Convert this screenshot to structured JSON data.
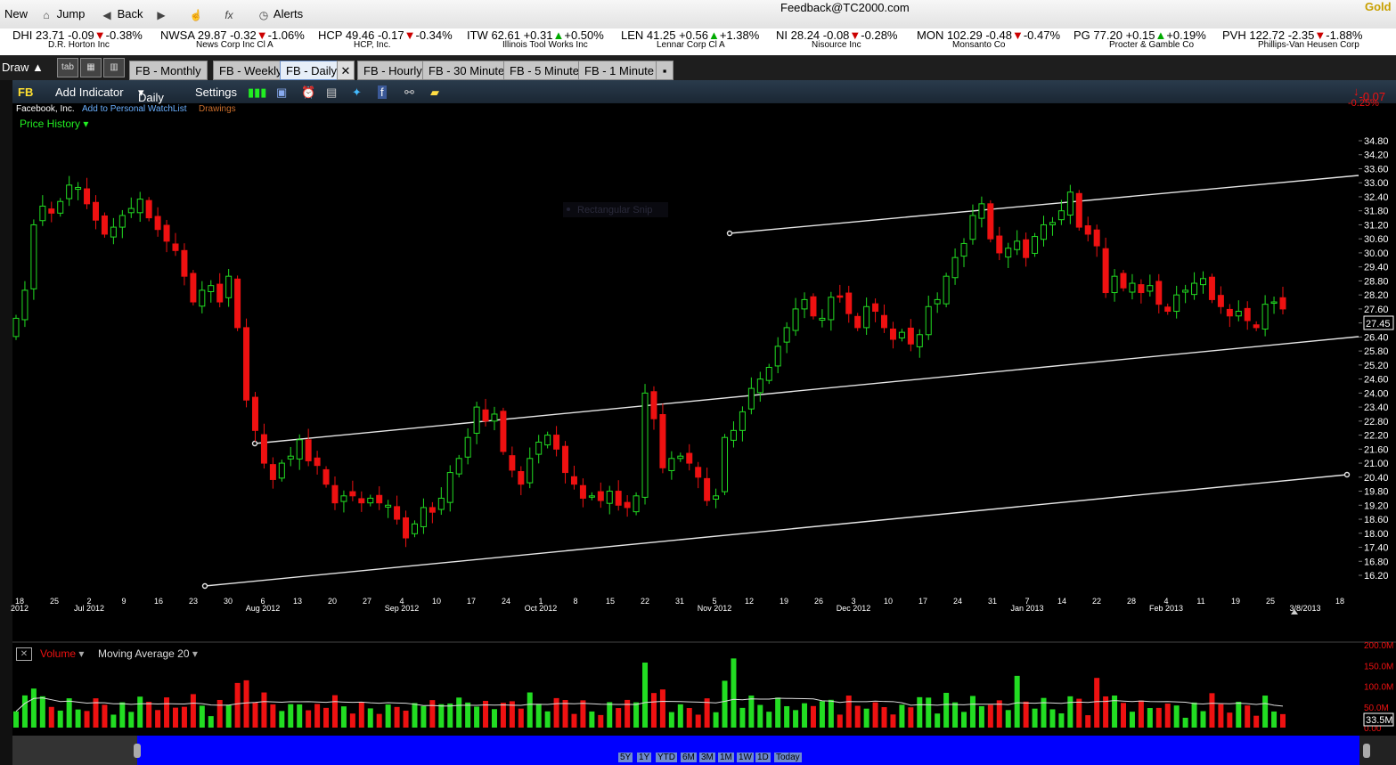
{
  "toolbar": {
    "new_label": "New",
    "jump_label": "Jump",
    "back_label": "Back",
    "alerts_label": "Alerts",
    "feedback": "Feedback@TC2000.com",
    "gold": "Gold"
  },
  "tickers": [
    {
      "sym": "DHI",
      "price": "23.71",
      "chg": "-0.09",
      "pct": "-0.38%",
      "dir": "dn",
      "name": "D.R. Horton Inc"
    },
    {
      "sym": "NWSA",
      "price": "29.87",
      "chg": "-0.32",
      "pct": "-1.06%",
      "dir": "dn",
      "name": "News Corp Inc Cl A"
    },
    {
      "sym": "HCP",
      "price": "49.46",
      "chg": "-0.17",
      "pct": "-0.34%",
      "dir": "dn",
      "name": "HCP, Inc."
    },
    {
      "sym": "ITW",
      "price": "62.61",
      "chg": "+0.31",
      "pct": "+0.50%",
      "dir": "up",
      "name": "Illinois Tool Works Inc"
    },
    {
      "sym": "LEN",
      "price": "41.25",
      "chg": "+0.56",
      "pct": "+1.38%",
      "dir": "up",
      "name": "Lennar Corp Cl A"
    },
    {
      "sym": "NI",
      "price": "28.24",
      "chg": "-0.08",
      "pct": "-0.28%",
      "dir": "dn",
      "name": "Nisource Inc"
    },
    {
      "sym": "MON",
      "price": "102.29",
      "chg": "-0.48",
      "pct": "-0.47%",
      "dir": "dn",
      "name": "Monsanto Co"
    },
    {
      "sym": "PG",
      "price": "77.20",
      "chg": "+0.15",
      "pct": "+0.19%",
      "dir": "up",
      "name": "Procter & Gamble Co"
    },
    {
      "sym": "PVH",
      "price": "122.72",
      "chg": "-2.35",
      "pct": "-1.88%",
      "dir": "dn",
      "name": "Phillips-Van Heusen Corp"
    }
  ],
  "tabbar": {
    "draw_label": "Draw",
    "tab_label": "tab",
    "tabs": [
      "FB - Monthly",
      "FB - Weekly",
      "FB - Daily",
      "FB - Hourly",
      "FB - 30 Minute",
      "FB - 5 Minute",
      "FB - 1 Minute"
    ],
    "active_tab": "FB - Daily"
  },
  "chart_header": {
    "symbol": "FB",
    "add_indicator": "Add Indicator",
    "period": "Daily",
    "settings": "Settings",
    "company": "Facebook, Inc.",
    "watchlist": "Add to Personal WatchList",
    "drawings": "Drawings",
    "price_history": "Price History",
    "change": "-0.07",
    "change_pct": "-0.25%",
    "last_price": "27.45",
    "snip_label": "Rectangular Snip",
    "date_stamp": "3/8/2013"
  },
  "chart_data": {
    "type": "candlestick",
    "price_axis": [
      "34.80",
      "34.20",
      "33.60",
      "33.00",
      "32.40",
      "31.80",
      "31.20",
      "30.60",
      "30.00",
      "29.40",
      "28.80",
      "28.20",
      "27.60",
      "27.00",
      "26.40",
      "25.80",
      "25.20",
      "24.60",
      "24.00",
      "23.40",
      "22.80",
      "22.20",
      "21.60",
      "21.00",
      "20.40",
      "19.80",
      "19.20",
      "18.60",
      "18.00",
      "17.40",
      "16.80",
      "16.20"
    ],
    "ylim": [
      16.0,
      35.0
    ],
    "x_ticks": [
      {
        "d": "18",
        "m": "2012"
      },
      {
        "d": "25",
        "m": ""
      },
      {
        "d": "2",
        "m": "Jul 2012"
      },
      {
        "d": "9",
        "m": ""
      },
      {
        "d": "16",
        "m": ""
      },
      {
        "d": "23",
        "m": ""
      },
      {
        "d": "30",
        "m": ""
      },
      {
        "d": "6",
        "m": "Aug 2012"
      },
      {
        "d": "13",
        "m": ""
      },
      {
        "d": "20",
        "m": ""
      },
      {
        "d": "27",
        "m": ""
      },
      {
        "d": "4",
        "m": "Sep 2012"
      },
      {
        "d": "10",
        "m": ""
      },
      {
        "d": "17",
        "m": ""
      },
      {
        "d": "24",
        "m": ""
      },
      {
        "d": "1",
        "m": "Oct 2012"
      },
      {
        "d": "8",
        "m": ""
      },
      {
        "d": "15",
        "m": ""
      },
      {
        "d": "22",
        "m": ""
      },
      {
        "d": "31",
        "m": ""
      },
      {
        "d": "5",
        "m": "Nov 2012"
      },
      {
        "d": "12",
        "m": ""
      },
      {
        "d": "19",
        "m": ""
      },
      {
        "d": "26",
        "m": ""
      },
      {
        "d": "3",
        "m": "Dec 2012"
      },
      {
        "d": "10",
        "m": ""
      },
      {
        "d": "17",
        "m": ""
      },
      {
        "d": "24",
        "m": ""
      },
      {
        "d": "31",
        "m": ""
      },
      {
        "d": "7",
        "m": "Jan 2013"
      },
      {
        "d": "14",
        "m": ""
      },
      {
        "d": "22",
        "m": ""
      },
      {
        "d": "28",
        "m": ""
      },
      {
        "d": "4",
        "m": "Feb 2013"
      },
      {
        "d": "11",
        "m": ""
      },
      {
        "d": "19",
        "m": ""
      },
      {
        "d": "25",
        "m": ""
      },
      {
        "d": "",
        "m": "3/8/2013"
      },
      {
        "d": "18",
        "m": ""
      }
    ],
    "closes": [
      27.2,
      28.4,
      31.2,
      32.0,
      31.7,
      32.2,
      32.9,
      32.8,
      32.1,
      31.4,
      30.8,
      31.1,
      31.6,
      31.9,
      32.3,
      31.5,
      31.0,
      30.5,
      30.1,
      29.0,
      27.9,
      28.4,
      28.6,
      27.9,
      29.0,
      26.8,
      23.7,
      22.4,
      21.0,
      20.3,
      21.0,
      21.3,
      22.0,
      21.1,
      20.9,
      20.1,
      19.3,
      19.6,
      19.6,
      19.3,
      19.5,
      19.3,
      19.2,
      18.6,
      17.8,
      18.4,
      19.1,
      18.9,
      19.5,
      20.6,
      21.2,
      22.1,
      23.4,
      22.8,
      23.1,
      21.5,
      20.7,
      20.1,
      21.2,
      21.9,
      22.2,
      21.6,
      20.6,
      20.1,
      19.5,
      19.6,
      19.4,
      19.8,
      19.2,
      19.1,
      19.6,
      24.0,
      22.9,
      20.8,
      21.2,
      21.3,
      21.0,
      20.4,
      19.4,
      19.6,
      22.1,
      22.4,
      23.2,
      24.2,
      24.6,
      25.1,
      26.0,
      26.8,
      27.6,
      28.0,
      27.3,
      27.2,
      28.1,
      28.1,
      27.4,
      26.8,
      27.7,
      27.5,
      26.8,
      26.3,
      26.6,
      26.1,
      26.5,
      27.7,
      28.0,
      29.0,
      29.8,
      30.4,
      31.6,
      32.1,
      30.6,
      30.0,
      30.2,
      30.5,
      29.8,
      30.7,
      31.2,
      31.3,
      31.8,
      32.6,
      31.1,
      30.8,
      30.3,
      28.3,
      29.0,
      28.5,
      28.7,
      28.3,
      28.6,
      27.8,
      27.5,
      28.2,
      28.4,
      28.7,
      28.9,
      28.0,
      27.7,
      27.3,
      27.5,
      27.1,
      26.8,
      27.8,
      27.9,
      27.6
    ],
    "volume_axis": [
      "200.0M",
      "150.0M",
      "100.0M",
      "50.0M",
      "0.00"
    ],
    "volume_last": "33.5M",
    "volume_label": "Volume",
    "ma_label": "Moving Average 20"
  },
  "range_buttons": [
    "5Y",
    "1Y",
    "YTD",
    "6M",
    "3M",
    "1M",
    "1W",
    "1D",
    "Today"
  ],
  "colors": {
    "up": "#22dd22",
    "down": "#ee1111",
    "price_text": "#ffffff",
    "volume_ma": "#dddddd"
  }
}
